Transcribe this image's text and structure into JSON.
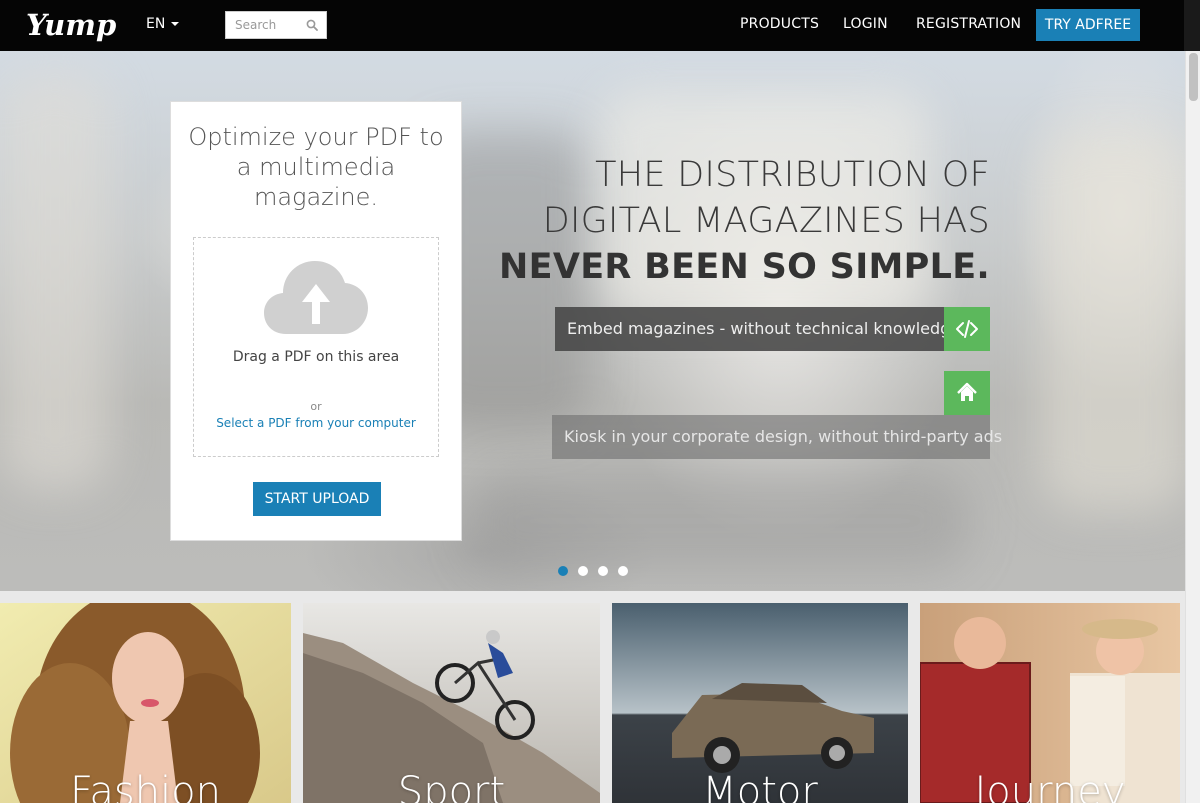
{
  "nav": {
    "logo": "Yumpu",
    "language": "EN",
    "search_placeholder": "Search",
    "products": "PRODUCTS",
    "login": "LOGIN",
    "registration": "REGISTRATION",
    "cta": "TRY ADFREE"
  },
  "upload": {
    "title": "Optimize your PDF to a multimedia magazine.",
    "drag_text": "Drag a PDF on this area",
    "or_text": "or",
    "select_link": "Select a PDF from your computer",
    "button": "START UPLOAD"
  },
  "hero": {
    "line1": "THE DISTRIBUTION OF",
    "line2": "DIGITAL MAGAZINES HAS",
    "line3": "NEVER BEEN SO SIMPLE."
  },
  "features": [
    {
      "text": "Embed magazines - without technical knowledge",
      "icon": "code-icon"
    },
    {
      "text": "Kiosk in your corporate design, without third-party ads",
      "icon": "home-icon"
    }
  ],
  "carousel": {
    "slides": 4,
    "active": 1
  },
  "categories": [
    {
      "label": "Fashion"
    },
    {
      "label": "Sport"
    },
    {
      "label": "Motor"
    },
    {
      "label": "Journey"
    }
  ],
  "colors": {
    "accent": "#1a80b6",
    "feature_green": "#5cb85c",
    "navbar": "#050505"
  }
}
